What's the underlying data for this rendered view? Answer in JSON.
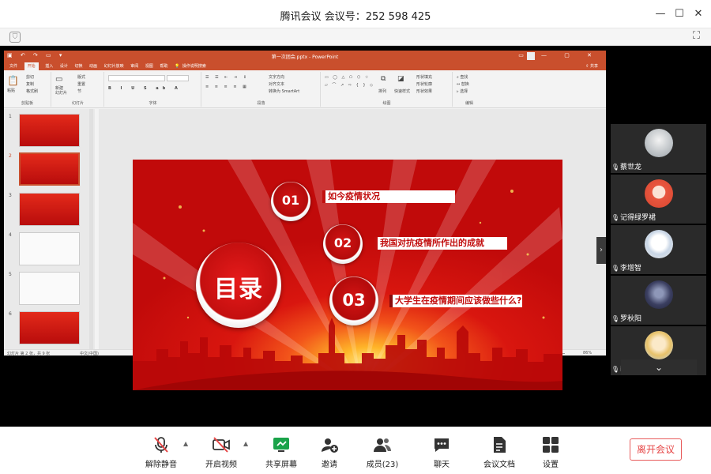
{
  "app": {
    "title": "腾讯会议 会议号：252 598 425"
  },
  "ppt": {
    "file_title": "第一次团会.pptx - PowerPoint",
    "share_label": "共享",
    "tabs": [
      "文件",
      "开始",
      "插入",
      "设计",
      "切换",
      "动画",
      "幻灯片放映",
      "审阅",
      "视图",
      "帮助"
    ],
    "tell_me": "操作说明搜索",
    "ribbon": {
      "paste": "粘贴",
      "cut": "剪切",
      "copy": "复制",
      "format_painter": "格式刷",
      "clipboard": "剪贴板",
      "new_slide": "新建\n幻灯片",
      "layout": "版式",
      "reset": "重置",
      "section": "节",
      "slides": "幻灯片",
      "font_group": "字体",
      "text_direction": "文字方向",
      "align_text": "对齐文本",
      "smartart": "转换为 SmartArt",
      "paragraph": "段落",
      "arrange": "排列",
      "quick_styles": "快速样式",
      "shape_fill": "形状填充",
      "shape_outline": "形状轮廓",
      "shape_effects": "形状效果",
      "drawing": "绘图",
      "find": "查找",
      "replace": "替换",
      "select": "选择",
      "editing": "编辑"
    },
    "slide_numbers": [
      "1",
      "2",
      "3",
      "4",
      "5",
      "6"
    ],
    "status_left": "幻灯片 第 2 张，共 9 张",
    "status_lang": "中文(中国)",
    "status_notes": "备注",
    "status_comments": "批注",
    "zoom": "86%"
  },
  "slide": {
    "title": "目录",
    "items": [
      {
        "num": "01",
        "text": "如今疫情状况"
      },
      {
        "num": "02",
        "text": "我国对抗疫情所作出的成就"
      },
      {
        "num": "03",
        "text": "大学生在疫情期间应该做些什么?"
      }
    ]
  },
  "participants": [
    {
      "name": "蔡世龙"
    },
    {
      "name": "记得绿罗裙"
    },
    {
      "name": "李增智"
    },
    {
      "name": "罗秋阳"
    },
    {
      "name": "iiiiii"
    }
  ],
  "bottom": {
    "mute": "解除静音",
    "video": "开启视频",
    "share": "共享屏幕",
    "invite": "邀请",
    "members": "成员(23)",
    "chat": "聊天",
    "docs": "会议文档",
    "settings": "设置",
    "leave": "离开会议"
  },
  "colors": {
    "ppt_accent": "#c94f2d",
    "slide_red": "#c20f0f",
    "leave_red": "#e64545"
  }
}
